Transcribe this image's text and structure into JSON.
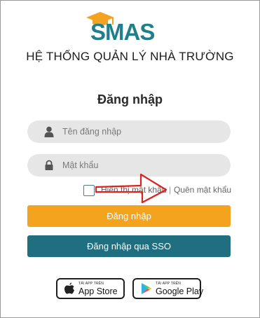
{
  "logo": {
    "text": "SMAS"
  },
  "system_title": "HỆ THỐNG QUẢN LÝ NHÀ TRƯỜNG",
  "login_heading": "Đăng nhập",
  "username": {
    "placeholder": "Tên đăng nhập",
    "icon": "user-icon"
  },
  "password": {
    "placeholder": "Mật khẩu",
    "icon": "lock-icon"
  },
  "show_password_label": "Hiển thị mật khẩu",
  "separator": "|",
  "forgot_password_label": "Quên mật khẩu",
  "login_button_label": "Đăng nhập",
  "sso_button_label": "Đăng nhập qua SSO",
  "app_store": {
    "small": "TẢI APP TRÊN",
    "big": "App Store"
  },
  "google_play": {
    "small": "TẢI APP TRÊN",
    "big": "Google Play"
  },
  "colors": {
    "accent_orange": "#f4a31e",
    "accent_teal": "#1f6f80",
    "annotation_red": "#e02020"
  }
}
